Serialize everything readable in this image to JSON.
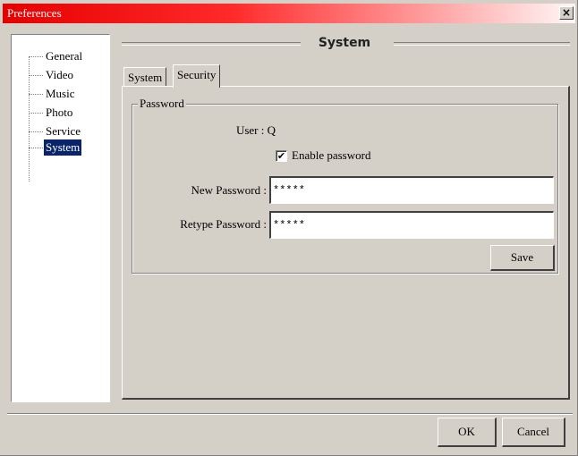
{
  "window": {
    "title": "Preferences",
    "close_glyph": "×"
  },
  "tree": {
    "items": [
      {
        "label": "General"
      },
      {
        "label": "Video"
      },
      {
        "label": "Music"
      },
      {
        "label": "Photo"
      },
      {
        "label": "Service"
      },
      {
        "label": "System",
        "selected": true
      }
    ]
  },
  "header": {
    "title": "System"
  },
  "tabs": [
    {
      "label": "System"
    },
    {
      "label": "Security",
      "active": true
    }
  ],
  "password_group": {
    "legend": "Password",
    "user_label": "User : Q",
    "enable_password": {
      "label": "Enable password",
      "checked": true,
      "glyph": "✔"
    },
    "new_password": {
      "label": "New Password :",
      "value": "*****"
    },
    "retype_password": {
      "label": "Retype Password :",
      "value": "*****"
    },
    "save_label": "Save"
  },
  "footer": {
    "ok_label": "OK",
    "cancel_label": "Cancel"
  },
  "colors": {
    "titlebar": "#e60000",
    "selection": "#0a246a",
    "face": "#d4d0c8"
  }
}
